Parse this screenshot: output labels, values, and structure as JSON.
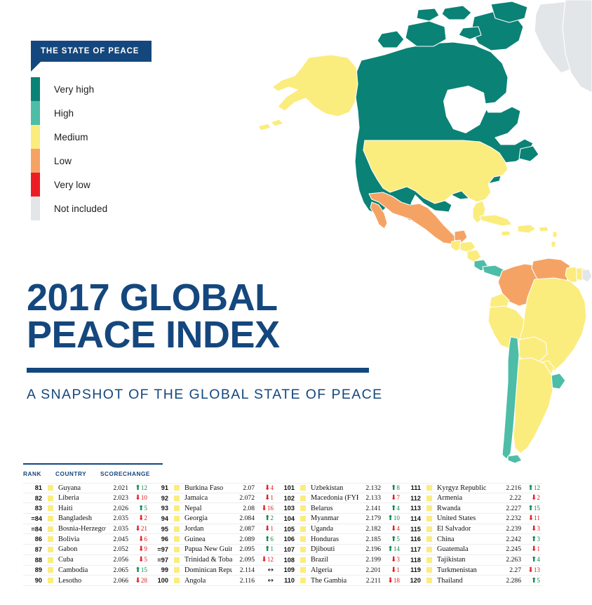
{
  "legend": {
    "banner_title": "THE STATE OF PEACE",
    "items": [
      {
        "label": "Very high",
        "color": "#0b8276"
      },
      {
        "label": "High",
        "color": "#4dbda7"
      },
      {
        "label": "Medium",
        "color": "#fbec7e"
      },
      {
        "label": "Low",
        "color": "#f5a364"
      },
      {
        "label": "Very low",
        "color": "#ed1c24"
      },
      {
        "label": "Not included",
        "color": "#e3e6e8"
      }
    ]
  },
  "title": {
    "line1": "2017 GLOBAL",
    "line2": "PEACE INDEX",
    "subtitle": "A SNAPSHOT OF THE GLOBAL STATE OF PEACE",
    "accent_color": "#14477d"
  },
  "table": {
    "headers": {
      "rank": "RANK",
      "country": "COUNTRY",
      "score": "SCORE",
      "change": "CHANGE"
    },
    "columns": [
      {
        "rows": [
          {
            "rank": "81",
            "swatch": "#fbec7e",
            "country": "Guyana",
            "score": "2.021",
            "dir": "up",
            "change": "12"
          },
          {
            "rank": "82",
            "swatch": "#fbec7e",
            "country": "Liberia",
            "score": "2.023",
            "dir": "down",
            "change": "10"
          },
          {
            "rank": "83",
            "swatch": "#fbec7e",
            "country": "Haiti",
            "score": "2.026",
            "dir": "up",
            "change": "5"
          },
          {
            "rank": "=84",
            "swatch": "#fbec7e",
            "country": "Bangladesh",
            "score": "2.035",
            "dir": "down",
            "change": "2"
          },
          {
            "rank": "=84",
            "swatch": "#fbec7e",
            "country": "Bosnia-Herzegovina",
            "score": "2.035",
            "dir": "down",
            "change": "21"
          },
          {
            "rank": "86",
            "swatch": "#fbec7e",
            "country": "Bolivia",
            "score": "2.045",
            "dir": "down",
            "change": "6"
          },
          {
            "rank": "87",
            "swatch": "#fbec7e",
            "country": "Gabon",
            "score": "2.052",
            "dir": "down",
            "change": "9"
          },
          {
            "rank": "88",
            "swatch": "#fbec7e",
            "country": "Cuba",
            "score": "2.056",
            "dir": "down",
            "change": "5"
          },
          {
            "rank": "89",
            "swatch": "#fbec7e",
            "country": "Cambodia",
            "score": "2.065",
            "dir": "up",
            "change": "15"
          },
          {
            "rank": "90",
            "swatch": "#fbec7e",
            "country": "Lesotho",
            "score": "2.066",
            "dir": "down",
            "change": "28"
          }
        ]
      },
      {
        "rows": [
          {
            "rank": "91",
            "swatch": "#fbec7e",
            "country": "Burkina Faso",
            "score": "2.07",
            "dir": "down",
            "change": "4"
          },
          {
            "rank": "92",
            "swatch": "#fbec7e",
            "country": "Jamaica",
            "score": "2.072",
            "dir": "down",
            "change": "1"
          },
          {
            "rank": "93",
            "swatch": "#fbec7e",
            "country": "Nepal",
            "score": "2.08",
            "dir": "down",
            "change": "16"
          },
          {
            "rank": "94",
            "swatch": "#fbec7e",
            "country": "Georgia",
            "score": "2.084",
            "dir": "up",
            "change": "2"
          },
          {
            "rank": "95",
            "swatch": "#fbec7e",
            "country": "Jordan",
            "score": "2.087",
            "dir": "down",
            "change": "1"
          },
          {
            "rank": "96",
            "swatch": "#fbec7e",
            "country": "Guinea",
            "score": "2.089",
            "dir": "up",
            "change": "6"
          },
          {
            "rank": "=97",
            "swatch": "#fbec7e",
            "country": "Papua New Guinea",
            "score": "2.095",
            "dir": "up",
            "change": "1"
          },
          {
            "rank": "=97",
            "swatch": "#fbec7e",
            "country": "Trinidad & Tobago",
            "score": "2.095",
            "dir": "down",
            "change": "12"
          },
          {
            "rank": "99",
            "swatch": "#fbec7e",
            "country": "Dominican Republic",
            "score": "2.114",
            "dir": "flat",
            "change": ""
          },
          {
            "rank": "100",
            "swatch": "#fbec7e",
            "country": "Angola",
            "score": "2.116",
            "dir": "flat",
            "change": ""
          }
        ]
      },
      {
        "rows": [
          {
            "rank": "101",
            "swatch": "#fbec7e",
            "country": "Uzbekistan",
            "score": "2.132",
            "dir": "up",
            "change": "8"
          },
          {
            "rank": "102",
            "swatch": "#fbec7e",
            "country": "Macedonia (FYR)",
            "score": "2.133",
            "dir": "down",
            "change": "7"
          },
          {
            "rank": "103",
            "swatch": "#fbec7e",
            "country": "Belarus",
            "score": "2.141",
            "dir": "up",
            "change": "4"
          },
          {
            "rank": "104",
            "swatch": "#fbec7e",
            "country": "Myanmar",
            "score": "2.179",
            "dir": "up",
            "change": "10"
          },
          {
            "rank": "105",
            "swatch": "#fbec7e",
            "country": "Uganda",
            "score": "2.182",
            "dir": "down",
            "change": "4"
          },
          {
            "rank": "106",
            "swatch": "#fbec7e",
            "country": "Honduras",
            "score": "2.185",
            "dir": "up",
            "change": "5"
          },
          {
            "rank": "107",
            "swatch": "#fbec7e",
            "country": "Djibouti",
            "score": "2.196",
            "dir": "up",
            "change": "14"
          },
          {
            "rank": "108",
            "swatch": "#fbec7e",
            "country": "Brazil",
            "score": "2.199",
            "dir": "down",
            "change": "3"
          },
          {
            "rank": "109",
            "swatch": "#fbec7e",
            "country": "Algeria",
            "score": "2.201",
            "dir": "down",
            "change": "1"
          },
          {
            "rank": "110",
            "swatch": "#fbec7e",
            "country": "The Gambia",
            "score": "2.211",
            "dir": "down",
            "change": "18"
          }
        ]
      },
      {
        "rows": [
          {
            "rank": "111",
            "swatch": "#fbec7e",
            "country": "Kyrgyz Republic",
            "score": "2.216",
            "dir": "up",
            "change": "12"
          },
          {
            "rank": "112",
            "swatch": "#fbec7e",
            "country": "Armenia",
            "score": "2.22",
            "dir": "down",
            "change": "2"
          },
          {
            "rank": "113",
            "swatch": "#fbec7e",
            "country": "Rwanda",
            "score": "2.227",
            "dir": "up",
            "change": "15"
          },
          {
            "rank": "114",
            "swatch": "#fbec7e",
            "country": "United States",
            "score": "2.232",
            "dir": "down",
            "change": "11"
          },
          {
            "rank": "115",
            "swatch": "#fbec7e",
            "country": "El Salvador",
            "score": "2.239",
            "dir": "down",
            "change": "3"
          },
          {
            "rank": "116",
            "swatch": "#fbec7e",
            "country": "China",
            "score": "2.242",
            "dir": "up",
            "change": "3"
          },
          {
            "rank": "117",
            "swatch": "#fbec7e",
            "country": "Guatemala",
            "score": "2.245",
            "dir": "down",
            "change": "1"
          },
          {
            "rank": "118",
            "swatch": "#fbec7e",
            "country": "Tajikistan",
            "score": "2.263",
            "dir": "up",
            "change": "4"
          },
          {
            "rank": "119",
            "swatch": "#fbec7e",
            "country": "Turkmenistan",
            "score": "2.27",
            "dir": "down",
            "change": "13"
          },
          {
            "rank": "120",
            "swatch": "#fbec7e",
            "country": "Thailand",
            "score": "2.286",
            "dir": "up",
            "change": "5"
          }
        ]
      }
    ]
  },
  "map": {
    "regions": [
      {
        "name": "Canada",
        "state": "Very high"
      },
      {
        "name": "Greenland",
        "state": "Not included"
      },
      {
        "name": "United States",
        "state": "Medium"
      },
      {
        "name": "Alaska",
        "state": "Medium"
      },
      {
        "name": "Mexico",
        "state": "Low"
      },
      {
        "name": "Guatemala",
        "state": "Medium"
      },
      {
        "name": "Belize",
        "state": "Medium"
      },
      {
        "name": "Honduras",
        "state": "Medium"
      },
      {
        "name": "El Salvador",
        "state": "Medium"
      },
      {
        "name": "Nicaragua",
        "state": "Medium"
      },
      {
        "name": "Costa Rica",
        "state": "High"
      },
      {
        "name": "Panama",
        "state": "High"
      },
      {
        "name": "Cuba",
        "state": "Medium"
      },
      {
        "name": "Jamaica",
        "state": "Medium"
      },
      {
        "name": "Haiti",
        "state": "Medium"
      },
      {
        "name": "Dominican Republic",
        "state": "Medium"
      },
      {
        "name": "Colombia",
        "state": "Low"
      },
      {
        "name": "Venezuela",
        "state": "Low"
      },
      {
        "name": "Guyana",
        "state": "Medium"
      },
      {
        "name": "Suriname",
        "state": "Medium"
      },
      {
        "name": "French Guiana",
        "state": "Not included"
      },
      {
        "name": "Ecuador",
        "state": "Medium"
      },
      {
        "name": "Peru",
        "state": "Medium"
      },
      {
        "name": "Brazil",
        "state": "Medium"
      },
      {
        "name": "Bolivia",
        "state": "Medium"
      },
      {
        "name": "Paraguay",
        "state": "Medium"
      },
      {
        "name": "Chile",
        "state": "High"
      },
      {
        "name": "Uruguay",
        "state": "High"
      },
      {
        "name": "Argentina",
        "state": "Medium"
      },
      {
        "name": "Western Europe edge",
        "state": "Not included"
      }
    ]
  }
}
